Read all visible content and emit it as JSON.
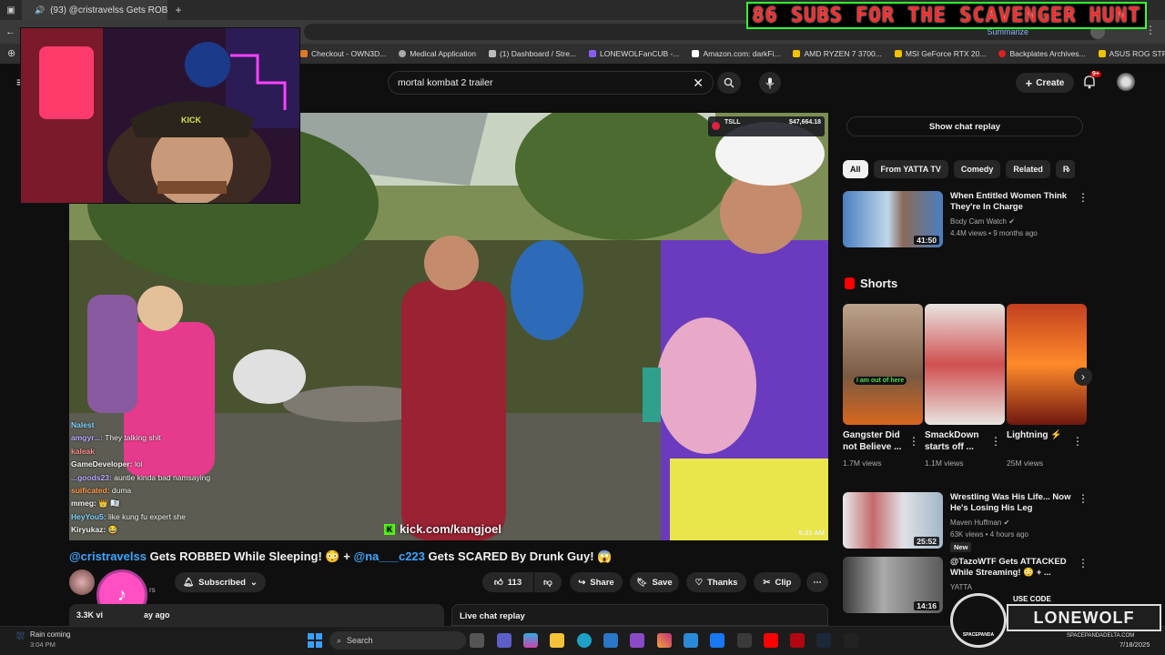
{
  "browser": {
    "tab_title": "(93) @cristravelss Gets ROB",
    "address_right": "Summarize",
    "bookmarks": [
      "Checkout - OWN3D...",
      "Medical Application",
      "(1) Dashboard / Stre...",
      "LONEWOLFanCUB -...",
      "Amazon.com: darkFi...",
      "AMD RYZEN 7 3700...",
      "MSI GeForce RTX 20...",
      "Backplates Archives...",
      "ASUS ROG STRIX B4..."
    ]
  },
  "banner": {
    "text": "86 SUBS FOR THE SCAVENGER HUNT"
  },
  "header": {
    "search_value": "mortal kombat 2 trailer",
    "create_label": "Create",
    "notifications_badge": "9+"
  },
  "video": {
    "watermark": "kick.com/kangjoel",
    "timestamp": "9:21 AM",
    "ticker": {
      "symbol": "TSLL",
      "price": "$47,664.18"
    },
    "webcam_hat": "KICK",
    "title_parts": [
      {
        "text": "@cristravelss",
        "type": "mention"
      },
      {
        "text": " Gets ROBBED While Sleeping! 😳 + ",
        "type": "text"
      },
      {
        "text": "@na___c223",
        "type": "mention"
      },
      {
        "text": " Gets SCARED By Drunk Guy! 😱",
        "type": "text"
      }
    ],
    "subscribed_label": "Subscribed",
    "likes": "113",
    "share_label": "Share",
    "save_label": "Save",
    "thanks_label": "Thanks",
    "clip_label": "Clip",
    "views_label": "3.3K vi",
    "ago_label": "ay ago",
    "live_chat_label": "Live chat replay",
    "subscriber_fragment": "rs"
  },
  "chat_overlay": [
    {
      "user": "Nalest",
      "msg": "",
      "color": "#7fd4ff"
    },
    {
      "user": "amgyr...:",
      "msg": "They talking shit",
      "color": "#bba6ff"
    },
    {
      "user": "kaleak",
      "msg": "",
      "color": "#ff8a8a"
    },
    {
      "user": "GameDeveloper:",
      "msg": "lol",
      "color": "#ffffff"
    },
    {
      "user": "...goods23:",
      "msg": "auntie kinda bad namsaying",
      "color": "#bba6ff"
    },
    {
      "user": "suificated:",
      "msg": "duma",
      "color": "#ff9a4a"
    },
    {
      "user": "mmeg:",
      "msg": "👑 🇷🇿",
      "color": "#ffffff"
    },
    {
      "user": "HeyYou5:",
      "msg": "like kung fu expert she",
      "color": "#7fd4ff"
    },
    {
      "user": "Kiryukaz:",
      "msg": "😂",
      "color": "#ffffff"
    }
  ],
  "sidebar": {
    "show_chat_replay": "Show chat replay",
    "chips": [
      "All",
      "From YATTA TV",
      "Comedy",
      "Related",
      "R"
    ],
    "recommendations_top": {
      "title": "When Entitled Women Think They're In Charge",
      "channel": "Body Cam Watch",
      "stats": "4.4M views • 9 months ago",
      "duration": "41:50"
    },
    "shorts_heading": "Shorts",
    "shorts": [
      {
        "title": "Gangster Did not Believe ...",
        "views": "1.7M views",
        "caption": "I am out of here"
      },
      {
        "title": "SmackDown starts off ...",
        "views": "1.1M views"
      },
      {
        "title": "Lightning ⚡",
        "views": "25M views"
      }
    ],
    "recommendations": [
      {
        "title": "Wrestling Was His Life... Now He's Losing His Leg",
        "channel": "Maven Huffman",
        "stats": "63K views • 4 hours ago",
        "badge": "New",
        "duration": "25:52"
      },
      {
        "title": "@TazoWTF Gets ATTACKED While Streaming! 😳 + ...",
        "channel": "YATTA",
        "stats": "",
        "duration": "14:16"
      }
    ]
  },
  "overlay_logo": {
    "use_code": "USE CODE",
    "code": "LONEWOLF",
    "site": "SPACEPANDADELTA.COM",
    "brand": "SPACEPANDA"
  },
  "taskbar": {
    "weather_title": "Rain coming",
    "weather_time": "3:04 PM",
    "search_placeholder": "Search",
    "date": "7/18/2025"
  },
  "colors": {
    "accent_red": "#ff0000",
    "mention_blue": "#3ea6ff",
    "banner_red": "#ff2a2a"
  }
}
